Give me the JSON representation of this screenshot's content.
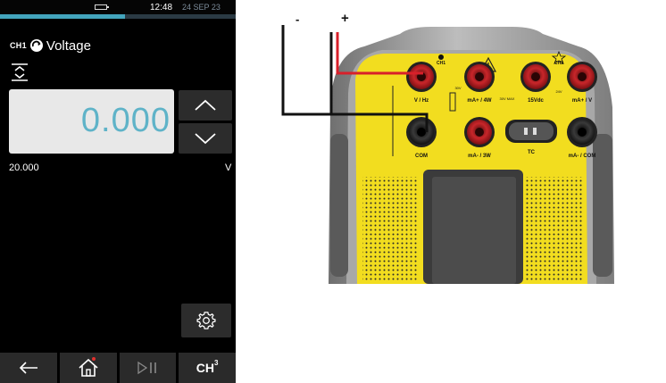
{
  "status_bar": {
    "time": "12:48",
    "date": "24 SEP 23",
    "progress_fraction": 0.53
  },
  "channel": {
    "label": "CH1",
    "function": "Voltage",
    "icon": "channel-arrow-icon"
  },
  "measurement": {
    "value": "0.000",
    "range": "20.000",
    "unit": "V"
  },
  "controls": {
    "increment_icon": "chevron-up-icon",
    "decrement_icon": "chevron-down-icon",
    "range_icon": "range-select-icon",
    "settings_icon": "gear-icon"
  },
  "nav": {
    "back_icon": "arrow-left-icon",
    "home_icon": "home-icon",
    "run_pause_icon": "play-pause-icon",
    "channel_label": "CH",
    "channel_sup": "3"
  },
  "diagram": {
    "lead_negative": "-",
    "lead_positive": "+",
    "colors": {
      "panel": "#f2dd1f",
      "lead_negative": "#111111",
      "lead_positive": "#d8202a",
      "housing": "#9a9a9a"
    },
    "terminals_top": [
      "V / Hz",
      "mA+ / 4W",
      "15Vdc",
      "mA+ / V"
    ],
    "terminals_bottom": [
      "COM",
      "mA- / 3W",
      "TC",
      "mA- / COM"
    ],
    "channel_marks": [
      "CH1",
      "CH2"
    ],
    "small_marks": [
      "30V MAX",
      "24V",
      "30V"
    ]
  }
}
